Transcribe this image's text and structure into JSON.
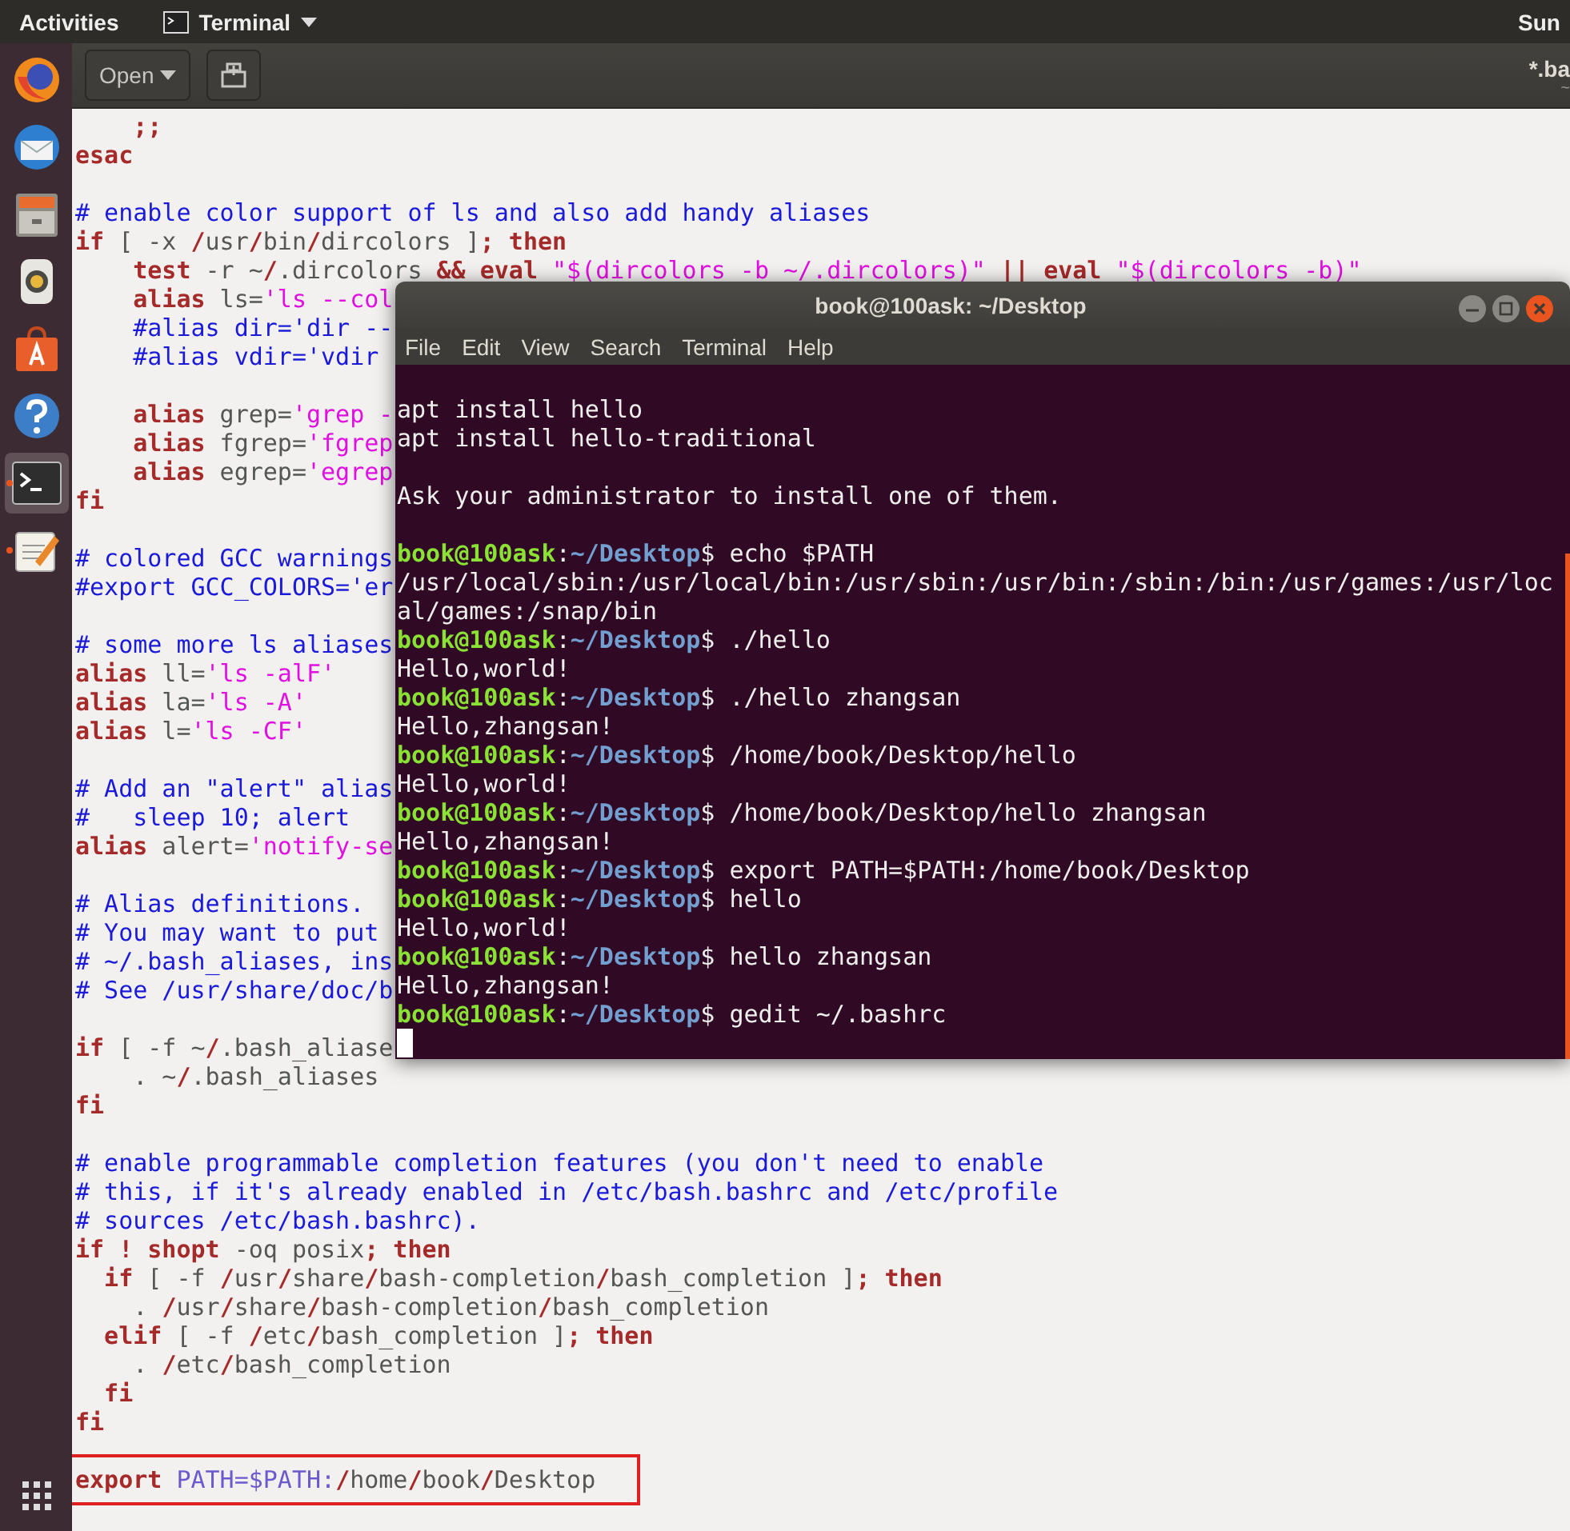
{
  "top_bar": {
    "activities": "Activities",
    "app_menu": "Terminal",
    "clock": "Sun"
  },
  "dock": {
    "items": [
      {
        "kind": "browser",
        "selected": false,
        "running": false
      },
      {
        "kind": "mail",
        "selected": false,
        "running": false
      },
      {
        "kind": "files",
        "selected": false,
        "running": false
      },
      {
        "kind": "speaker",
        "selected": false,
        "running": false
      },
      {
        "kind": "store",
        "selected": false,
        "running": false
      },
      {
        "kind": "help",
        "selected": false,
        "running": false
      },
      {
        "kind": "terminal",
        "selected": true,
        "running": true
      },
      {
        "kind": "editor",
        "selected": false,
        "running": true
      }
    ]
  },
  "editor": {
    "header": {
      "open_button": "Open",
      "title": "*.ba",
      "subtitle": "~"
    },
    "blocks": [
      {
        "highlighted": false,
        "lines": [
          [
            {
              "kind": "kw",
              "text": "    ;;"
            }
          ],
          [
            {
              "kind": "kw",
              "text": "esac"
            }
          ]
        ]
      },
      {
        "highlighted": false,
        "lines": [
          [
            {
              "kind": "cm",
              "text": "# enable color support of ls and also add handy aliases"
            }
          ],
          [
            {
              "kind": "kw",
              "text": "if"
            },
            {
              "kind": "txt",
              "text": " [ -x "
            },
            {
              "kind": "sep",
              "text": "/"
            },
            {
              "kind": "txt",
              "text": "usr"
            },
            {
              "kind": "sep",
              "text": "/"
            },
            {
              "kind": "txt",
              "text": "bin"
            },
            {
              "kind": "sep",
              "text": "/"
            },
            {
              "kind": "txt",
              "text": "dircolors ]"
            },
            {
              "kind": "kw",
              "text": "; then"
            }
          ],
          [
            {
              "kind": "kw",
              "text": "    test"
            },
            {
              "kind": "txt",
              "text": " -r ~"
            },
            {
              "kind": "sep",
              "text": "/"
            },
            {
              "kind": "txt",
              "text": ".dircolors "
            },
            {
              "kind": "kw",
              "text": "&& eval"
            },
            {
              "kind": "str",
              "text": " \"$(dircolors -b ~/.dircolors)\""
            },
            {
              "kind": "kw",
              "text": " || eval"
            },
            {
              "kind": "str",
              "text": " \"$(dircolors -b)\""
            }
          ],
          [
            {
              "kind": "kw",
              "text": "    alias"
            },
            {
              "kind": "txt",
              "text": " ls="
            },
            {
              "kind": "str",
              "text": "'ls --col"
            }
          ],
          [
            {
              "kind": "cm",
              "text": "    #alias dir='dir --"
            }
          ],
          [
            {
              "kind": "cm",
              "text": "    #alias vdir='vdir"
            }
          ]
        ]
      },
      {
        "highlighted": false,
        "lines": [
          [
            {
              "kind": "kw",
              "text": "    alias"
            },
            {
              "kind": "txt",
              "text": " grep="
            },
            {
              "kind": "str",
              "text": "'grep -"
            }
          ],
          [
            {
              "kind": "kw",
              "text": "    alias"
            },
            {
              "kind": "txt",
              "text": " fgrep="
            },
            {
              "kind": "str",
              "text": "'fgrep"
            }
          ],
          [
            {
              "kind": "kw",
              "text": "    alias"
            },
            {
              "kind": "txt",
              "text": " egrep="
            },
            {
              "kind": "str",
              "text": "'egrep"
            }
          ],
          [
            {
              "kind": "kw",
              "text": "fi"
            }
          ]
        ]
      },
      {
        "highlighted": false,
        "lines": [
          [
            {
              "kind": "cm",
              "text": "# colored GCC warnings"
            }
          ],
          [
            {
              "kind": "cm",
              "text": "#export GCC_COLORS='er"
            }
          ]
        ]
      },
      {
        "highlighted": false,
        "lines": [
          [
            {
              "kind": "cm",
              "text": "# some more ls aliases"
            }
          ],
          [
            {
              "kind": "kw",
              "text": "alias"
            },
            {
              "kind": "txt",
              "text": " ll="
            },
            {
              "kind": "str",
              "text": "'ls -alF'"
            }
          ],
          [
            {
              "kind": "kw",
              "text": "alias"
            },
            {
              "kind": "txt",
              "text": " la="
            },
            {
              "kind": "str",
              "text": "'ls -A'"
            }
          ],
          [
            {
              "kind": "kw",
              "text": "alias"
            },
            {
              "kind": "txt",
              "text": " l="
            },
            {
              "kind": "str",
              "text": "'ls -CF'"
            }
          ]
        ]
      },
      {
        "highlighted": false,
        "lines": [
          [
            {
              "kind": "cm",
              "text": "# Add an \"alert\" alias"
            }
          ],
          [
            {
              "kind": "cm",
              "text": "#   sleep 10; alert"
            }
          ],
          [
            {
              "kind": "kw",
              "text": "alias"
            },
            {
              "kind": "txt",
              "text": " alert="
            },
            {
              "kind": "str",
              "text": "'notify-se"
            }
          ]
        ]
      },
      {
        "highlighted": false,
        "lines": [
          [
            {
              "kind": "cm",
              "text": "# Alias definitions."
            }
          ],
          [
            {
              "kind": "cm",
              "text": "# You may want to put"
            }
          ],
          [
            {
              "kind": "cm",
              "text": "# ~/.bash_aliases, ins"
            }
          ],
          [
            {
              "kind": "cm",
              "text": "# See /usr/share/doc/b"
            }
          ]
        ]
      },
      {
        "highlighted": false,
        "lines": [
          [
            {
              "kind": "kw",
              "text": "if"
            },
            {
              "kind": "txt",
              "text": " [ -f ~"
            },
            {
              "kind": "sep",
              "text": "/"
            },
            {
              "kind": "txt",
              "text": ".bash_aliase"
            }
          ],
          [
            {
              "kind": "txt",
              "text": "    . ~"
            },
            {
              "kind": "sep",
              "text": "/"
            },
            {
              "kind": "txt",
              "text": ".bash_aliases"
            }
          ],
          [
            {
              "kind": "kw",
              "text": "fi"
            }
          ]
        ]
      },
      {
        "highlighted": false,
        "lines": [
          [
            {
              "kind": "cm",
              "text": "# enable programmable completion features (you don't need to enable"
            }
          ],
          [
            {
              "kind": "cm",
              "text": "# this, if it's already enabled in /etc/bash.bashrc and /etc/profile"
            }
          ],
          [
            {
              "kind": "cm",
              "text": "# sources /etc/bash.bashrc)."
            }
          ],
          [
            {
              "kind": "kw",
              "text": "if ! shopt"
            },
            {
              "kind": "txt",
              "text": " -oq posix"
            },
            {
              "kind": "kw",
              "text": "; then"
            }
          ],
          [
            {
              "kind": "kw",
              "text": "  if"
            },
            {
              "kind": "txt",
              "text": " [ -f "
            },
            {
              "kind": "sep",
              "text": "/"
            },
            {
              "kind": "txt",
              "text": "usr"
            },
            {
              "kind": "sep",
              "text": "/"
            },
            {
              "kind": "txt",
              "text": "share"
            },
            {
              "kind": "sep",
              "text": "/"
            },
            {
              "kind": "txt",
              "text": "bash-completion"
            },
            {
              "kind": "sep",
              "text": "/"
            },
            {
              "kind": "txt",
              "text": "bash_completion ]"
            },
            {
              "kind": "kw",
              "text": "; then"
            }
          ],
          [
            {
              "kind": "txt",
              "text": "    . "
            },
            {
              "kind": "sep",
              "text": "/"
            },
            {
              "kind": "txt",
              "text": "usr"
            },
            {
              "kind": "sep",
              "text": "/"
            },
            {
              "kind": "txt",
              "text": "share"
            },
            {
              "kind": "sep",
              "text": "/"
            },
            {
              "kind": "txt",
              "text": "bash-completion"
            },
            {
              "kind": "sep",
              "text": "/"
            },
            {
              "kind": "txt",
              "text": "bash_completion"
            }
          ],
          [
            {
              "kind": "kw",
              "text": "  elif"
            },
            {
              "kind": "txt",
              "text": " [ -f "
            },
            {
              "kind": "sep",
              "text": "/"
            },
            {
              "kind": "txt",
              "text": "etc"
            },
            {
              "kind": "sep",
              "text": "/"
            },
            {
              "kind": "txt",
              "text": "bash_completion ]"
            },
            {
              "kind": "kw",
              "text": "; then"
            }
          ],
          [
            {
              "kind": "txt",
              "text": "    . "
            },
            {
              "kind": "sep",
              "text": "/"
            },
            {
              "kind": "txt",
              "text": "etc"
            },
            {
              "kind": "sep",
              "text": "/"
            },
            {
              "kind": "txt",
              "text": "bash_completion"
            }
          ],
          [
            {
              "kind": "kw",
              "text": "  fi"
            }
          ],
          [
            {
              "kind": "kw",
              "text": "fi"
            }
          ]
        ]
      },
      {
        "highlighted": true,
        "lines": [
          [
            {
              "kind": "kw",
              "text": "export"
            },
            {
              "kind": "var",
              "text": " PATH=$PATH:"
            },
            {
              "kind": "sep",
              "text": "/"
            },
            {
              "kind": "txt",
              "text": "home"
            },
            {
              "kind": "sep",
              "text": "/"
            },
            {
              "kind": "txt",
              "text": "book"
            },
            {
              "kind": "sep",
              "text": "/"
            },
            {
              "kind": "txt",
              "text": "Desktop"
            }
          ]
        ]
      }
    ]
  },
  "terminal": {
    "title": "book@100ask: ~/Desktop",
    "menu": [
      "File",
      "Edit",
      "View",
      "Search",
      "Terminal",
      "Help"
    ],
    "blocks": [
      [
        [
          {
            "kind": "out",
            "text": "apt install hello"
          }
        ],
        [
          {
            "kind": "out",
            "text": "apt install hello-traditional"
          }
        ]
      ],
      [
        [
          {
            "kind": "out",
            "text": "Ask your administrator to install one of them."
          }
        ]
      ],
      [
        [
          {
            "kind": "user",
            "text": "book@100ask"
          },
          {
            "kind": "out",
            "text": ":"
          },
          {
            "kind": "path",
            "text": "~/Desktop"
          },
          {
            "kind": "out",
            "text": "$ echo $PATH"
          }
        ],
        [
          {
            "kind": "out",
            "text": "/usr/local/sbin:/usr/local/bin:/usr/sbin:/usr/bin:/sbin:/bin:/usr/games:/usr/loc"
          }
        ],
        [
          {
            "kind": "out",
            "text": "al/games:/snap/bin"
          }
        ],
        [
          {
            "kind": "user",
            "text": "book@100ask"
          },
          {
            "kind": "out",
            "text": ":"
          },
          {
            "kind": "path",
            "text": "~/Desktop"
          },
          {
            "kind": "out",
            "text": "$ ./hello"
          }
        ],
        [
          {
            "kind": "out",
            "text": "Hello,world!"
          }
        ],
        [
          {
            "kind": "user",
            "text": "book@100ask"
          },
          {
            "kind": "out",
            "text": ":"
          },
          {
            "kind": "path",
            "text": "~/Desktop"
          },
          {
            "kind": "out",
            "text": "$ ./hello zhangsan"
          }
        ],
        [
          {
            "kind": "out",
            "text": "Hello,zhangsan!"
          }
        ],
        [
          {
            "kind": "user",
            "text": "book@100ask"
          },
          {
            "kind": "out",
            "text": ":"
          },
          {
            "kind": "path",
            "text": "~/Desktop"
          },
          {
            "kind": "out",
            "text": "$ /home/book/Desktop/hello"
          }
        ],
        [
          {
            "kind": "out",
            "text": "Hello,world!"
          }
        ],
        [
          {
            "kind": "user",
            "text": "book@100ask"
          },
          {
            "kind": "out",
            "text": ":"
          },
          {
            "kind": "path",
            "text": "~/Desktop"
          },
          {
            "kind": "out",
            "text": "$ /home/book/Desktop/hello zhangsan"
          }
        ],
        [
          {
            "kind": "out",
            "text": "Hello,zhangsan!"
          }
        ],
        [
          {
            "kind": "user",
            "text": "book@100ask"
          },
          {
            "kind": "out",
            "text": ":"
          },
          {
            "kind": "path",
            "text": "~/Desktop"
          },
          {
            "kind": "out",
            "text": "$ export PATH=$PATH:/home/book/Desktop"
          }
        ],
        [
          {
            "kind": "user",
            "text": "book@100ask"
          },
          {
            "kind": "out",
            "text": ":"
          },
          {
            "kind": "path",
            "text": "~/Desktop"
          },
          {
            "kind": "out",
            "text": "$ hello"
          }
        ],
        [
          {
            "kind": "out",
            "text": "Hello,world!"
          }
        ],
        [
          {
            "kind": "user",
            "text": "book@100ask"
          },
          {
            "kind": "out",
            "text": ":"
          },
          {
            "kind": "path",
            "text": "~/Desktop"
          },
          {
            "kind": "out",
            "text": "$ hello zhangsan"
          }
        ],
        [
          {
            "kind": "out",
            "text": "Hello,zhangsan!"
          }
        ],
        [
          {
            "kind": "user",
            "text": "book@100ask"
          },
          {
            "kind": "out",
            "text": ":"
          },
          {
            "kind": "path",
            "text": "~/Desktop"
          },
          {
            "kind": "out",
            "text": "$ gedit ~/.bashrc"
          }
        ]
      ]
    ]
  }
}
